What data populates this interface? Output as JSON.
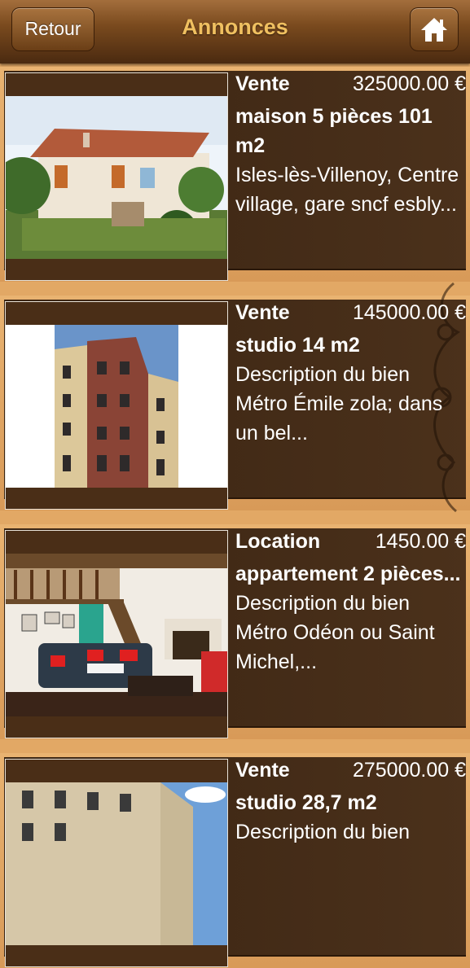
{
  "header": {
    "back_label": "Retour",
    "title": "Annonces"
  },
  "listings": [
    {
      "type": "Vente",
      "price": "325000.00 €",
      "headline": "maison 5 pièces 101 m2",
      "description": "Isles-lès-Villenoy, Centre village, gare sncf esbly..."
    },
    {
      "type": "Vente",
      "price": "145000.00 €",
      "headline": "studio 14 m2",
      "description": "Description du bien Métro Émile zola; dans un bel..."
    },
    {
      "type": "Location",
      "price": "1450.00 €",
      "headline": "appartement 2 pièces...",
      "description": "Description du bien Métro Odéon ou Saint Michel,..."
    },
    {
      "type": "Vente",
      "price": "275000.00 €",
      "headline": "studio 28,7 m2",
      "description": "Description du bien"
    }
  ],
  "colors": {
    "header_title": "#f0c060",
    "card_background": "#3a2412",
    "row_background": "#e2a865"
  }
}
